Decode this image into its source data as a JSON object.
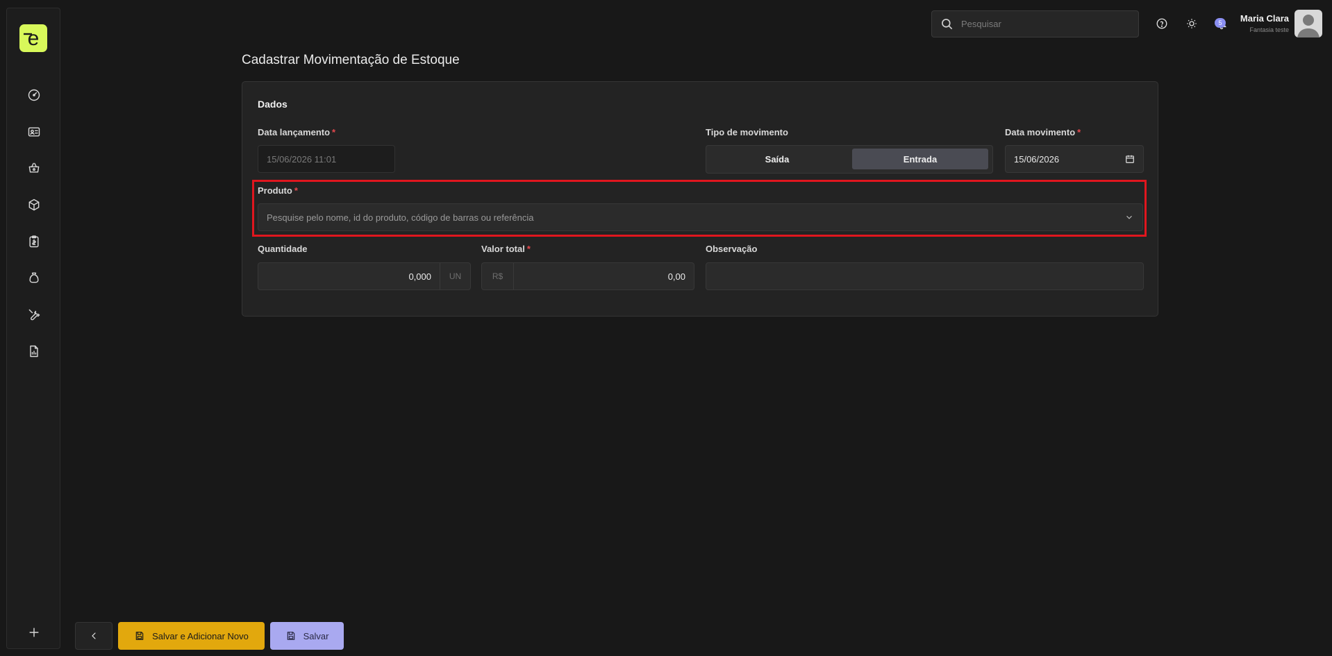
{
  "colors": {
    "logo_bg": "#d8f85a",
    "accent_yellow": "#e2a80d",
    "accent_purple": "#a9a9f0",
    "required_asterisk": "#e5484d",
    "highlight_border": "#e0161e",
    "badge": "#8b8ff2"
  },
  "sidebar": {
    "logo_letter": "e",
    "icons": [
      "dashboard-icon",
      "id-card-icon",
      "basket-icon",
      "box-icon",
      "clipboard-icon",
      "money-bag-icon",
      "wrench-icon",
      "report-icon",
      "plus-icon"
    ]
  },
  "topbar": {
    "search_placeholder": "Pesquisar",
    "notification_count": "5",
    "user_name": "Maria Clara",
    "user_company": "Fantasia teste"
  },
  "page": {
    "title": "Cadastrar Movimentação de Estoque"
  },
  "form": {
    "section_title": "Dados",
    "data_lancamento": {
      "label": "Data lançamento",
      "required_mark": "*",
      "value": "15/06/2026 11:01"
    },
    "tipo_movimento": {
      "label": "Tipo de movimento",
      "options": [
        "Saída",
        "Entrada"
      ],
      "selected": "Entrada"
    },
    "data_movimento": {
      "label": "Data movimento",
      "required_mark": "*",
      "value": "15/06/2026"
    },
    "produto": {
      "label": "Produto",
      "required_mark": "*",
      "placeholder": "Pesquise pelo nome, id do produto, código de barras ou referência"
    },
    "quantidade": {
      "label": "Quantidade",
      "value": "0,000",
      "unit": "UN"
    },
    "valor_total": {
      "label": "Valor total",
      "required_mark": "*",
      "prefix": "R$",
      "value": "0,00"
    },
    "observacao": {
      "label": "Observação",
      "value": ""
    }
  },
  "footer": {
    "save_new_label": "Salvar e Adicionar Novo",
    "save_label": "Salvar"
  }
}
